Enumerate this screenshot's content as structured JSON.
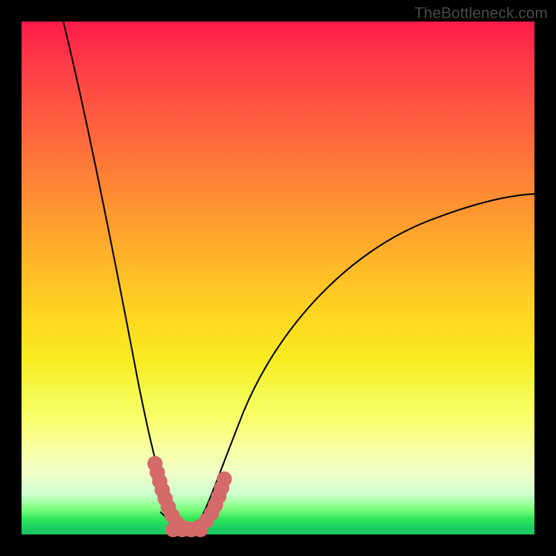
{
  "watermark": "TheBottleneck.com",
  "chart_data": {
    "type": "line",
    "title": "",
    "xlabel": "",
    "ylabel": "",
    "xlim": [
      0,
      100
    ],
    "ylim": [
      0,
      100
    ],
    "grid": false,
    "legend": false,
    "background": "rainbow-vertical-gradient (red top → green bottom)",
    "series": [
      {
        "name": "left-branch",
        "x": [
          8,
          10,
          12,
          14,
          16,
          18,
          20,
          22,
          24,
          25,
          26,
          27,
          28,
          29,
          30
        ],
        "y": [
          100,
          86,
          72,
          58,
          46,
          35,
          25,
          17,
          10,
          7,
          5,
          3.5,
          2.3,
          1.5,
          1.0
        ]
      },
      {
        "name": "valley-floor",
        "x": [
          27,
          28,
          29,
          30,
          31,
          32,
          33,
          34,
          35
        ],
        "y": [
          2.5,
          1.6,
          1.2,
          1.0,
          1.0,
          1.0,
          1.1,
          1.3,
          1.8
        ]
      },
      {
        "name": "right-branch",
        "x": [
          33,
          34,
          36,
          38,
          41,
          45,
          50,
          56,
          63,
          71,
          80,
          90,
          100
        ],
        "y": [
          1.0,
          1.5,
          3.0,
          5.8,
          10.5,
          17,
          24,
          31.5,
          39,
          46.5,
          53.5,
          60,
          66
        ]
      }
    ],
    "annotations": [
      {
        "name": "bead-overlay",
        "description": "salmon dotted thick stroke hugging the trough region on both inner walls and floor",
        "color": "#d46a6a"
      }
    ]
  }
}
